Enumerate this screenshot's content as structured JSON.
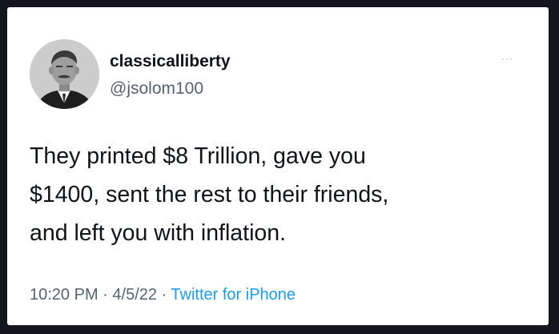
{
  "author": {
    "display_name": "classicalliberty",
    "handle": "@jsolom100",
    "avatar_icon": "profile-photo"
  },
  "more_icon": "ellipsis-icon",
  "more_glyph": "···",
  "tweet": {
    "lines": [
      "They printed $8 Trillion, gave you",
      "$1400, sent the rest to their friends,",
      "and left you with inflation."
    ]
  },
  "meta": {
    "time": "10:20 PM",
    "separator": " · ",
    "date": "4/5/22",
    "source": "Twitter for iPhone"
  },
  "colors": {
    "background": "#15161d",
    "card": "#ffffff",
    "text": "#0f1419",
    "secondary": "#536471",
    "link": "#1d9bf0"
  }
}
